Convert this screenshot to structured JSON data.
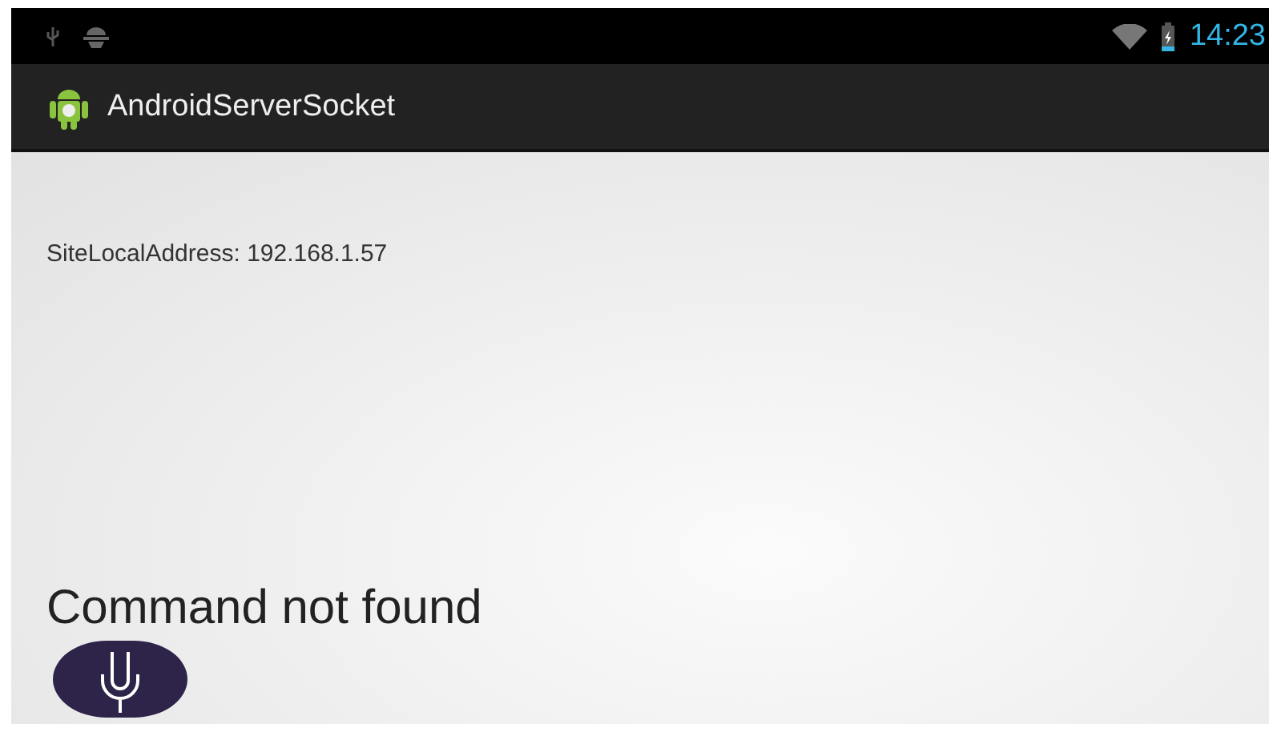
{
  "status_bar": {
    "time": "14:23"
  },
  "action_bar": {
    "title": "AndroidServerSocket"
  },
  "content": {
    "address_label": "SiteLocalAddress: 192.168.1.57",
    "message": "Command not found"
  }
}
